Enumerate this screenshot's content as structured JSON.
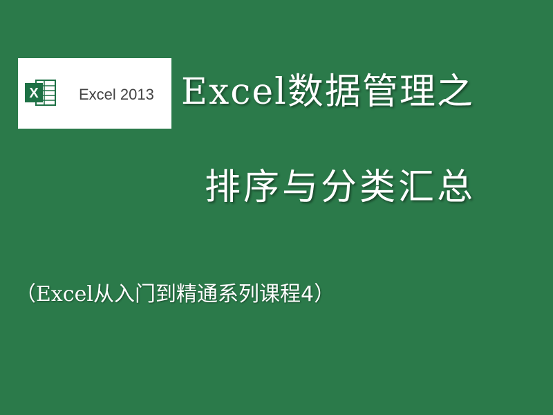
{
  "logo": {
    "text": "Excel 2013",
    "icon": "excel-icon",
    "letter": "X"
  },
  "title": {
    "line1_latin": "Excel",
    "line1_cjk": "数据管理之",
    "line2": "排序与分类汇总"
  },
  "subtitle": {
    "open": "（",
    "latin": "Excel",
    "cjk": "从入门到精通系列课程4",
    "close": "）"
  },
  "colors": {
    "background": "#2b7a4a",
    "excel_green": "#1e7145",
    "text": "#ffffff"
  }
}
